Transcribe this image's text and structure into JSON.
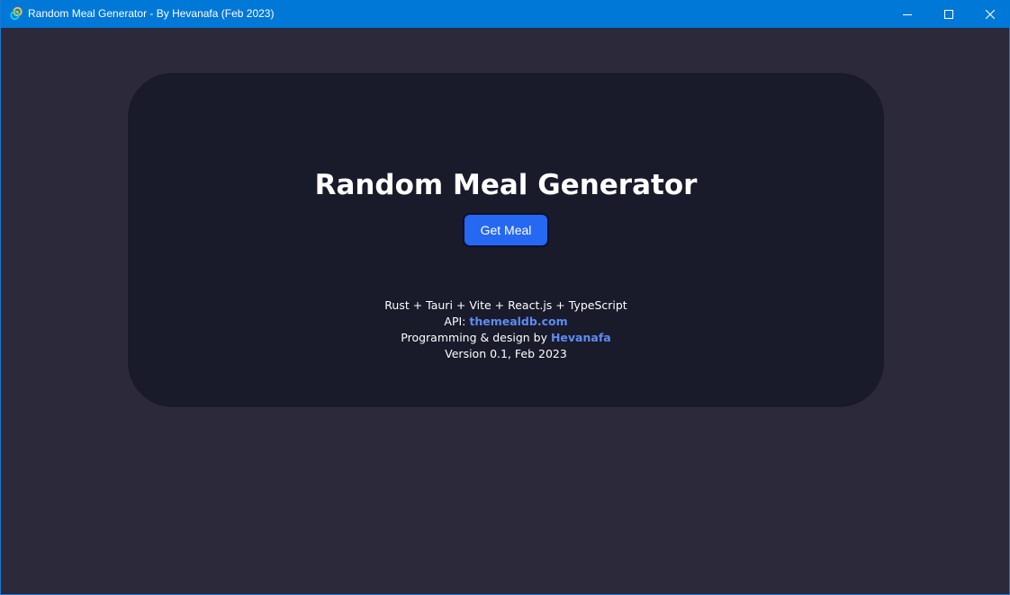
{
  "window": {
    "title": "Random Meal Generator - By Hevanafa (Feb 2023)",
    "controls": {
      "minimize": "minimize-icon",
      "maximize": "maximize-icon",
      "close": "close-icon"
    },
    "accent_color": "#0078d7"
  },
  "main": {
    "heading": "Random Meal Generator",
    "button_label": "Get Meal",
    "button_color": "#2668f2"
  },
  "credits": {
    "stack": "Rust + Tauri + Vite + React.js + TypeScript",
    "api_prefix": "API: ",
    "api_link": "themealdb.com",
    "author_prefix": "Programming & design by ",
    "author_link": "Hevanafa",
    "version": "Version 0.1, Feb 2023",
    "link_color": "#5d8cf2"
  },
  "colors": {
    "background": "#2c293b",
    "card": "#191a2a",
    "text": "#ffffff"
  }
}
